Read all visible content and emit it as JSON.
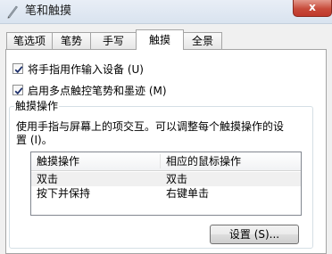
{
  "window": {
    "title": "笔和触摸",
    "close_label": "x"
  },
  "tabs": [
    {
      "label": "笔选项",
      "active": false
    },
    {
      "label": "笔势",
      "active": false
    },
    {
      "label": "手写",
      "active": false
    },
    {
      "label": "触摸",
      "active": true
    },
    {
      "label": "全景",
      "active": false
    }
  ],
  "options": {
    "use_finger_label": "将手指用作输入设备 (U)",
    "use_finger_checked": true,
    "multitouch_label": "启用多点触控笔势和墨迹 (M)",
    "multitouch_checked": true
  },
  "touch_actions": {
    "group_title": "触摸操作",
    "description": "使用手指与屏幕上的项交互。可以调整每个触摸操作的设置 (I)。",
    "columns": [
      "触摸操作",
      "相应的鼠标操作"
    ],
    "rows": [
      {
        "action": "双击",
        "mouse": "双击",
        "selected": true
      },
      {
        "action": "按下并保持",
        "mouse": "右键单击",
        "selected": false
      }
    ],
    "settings_button": "设置 (S)..."
  },
  "colors": {
    "close_button": "#c74a3a",
    "checkmark": "#1c2f6b",
    "panel": "#ffffff",
    "chrome": "#f0f0f0"
  }
}
